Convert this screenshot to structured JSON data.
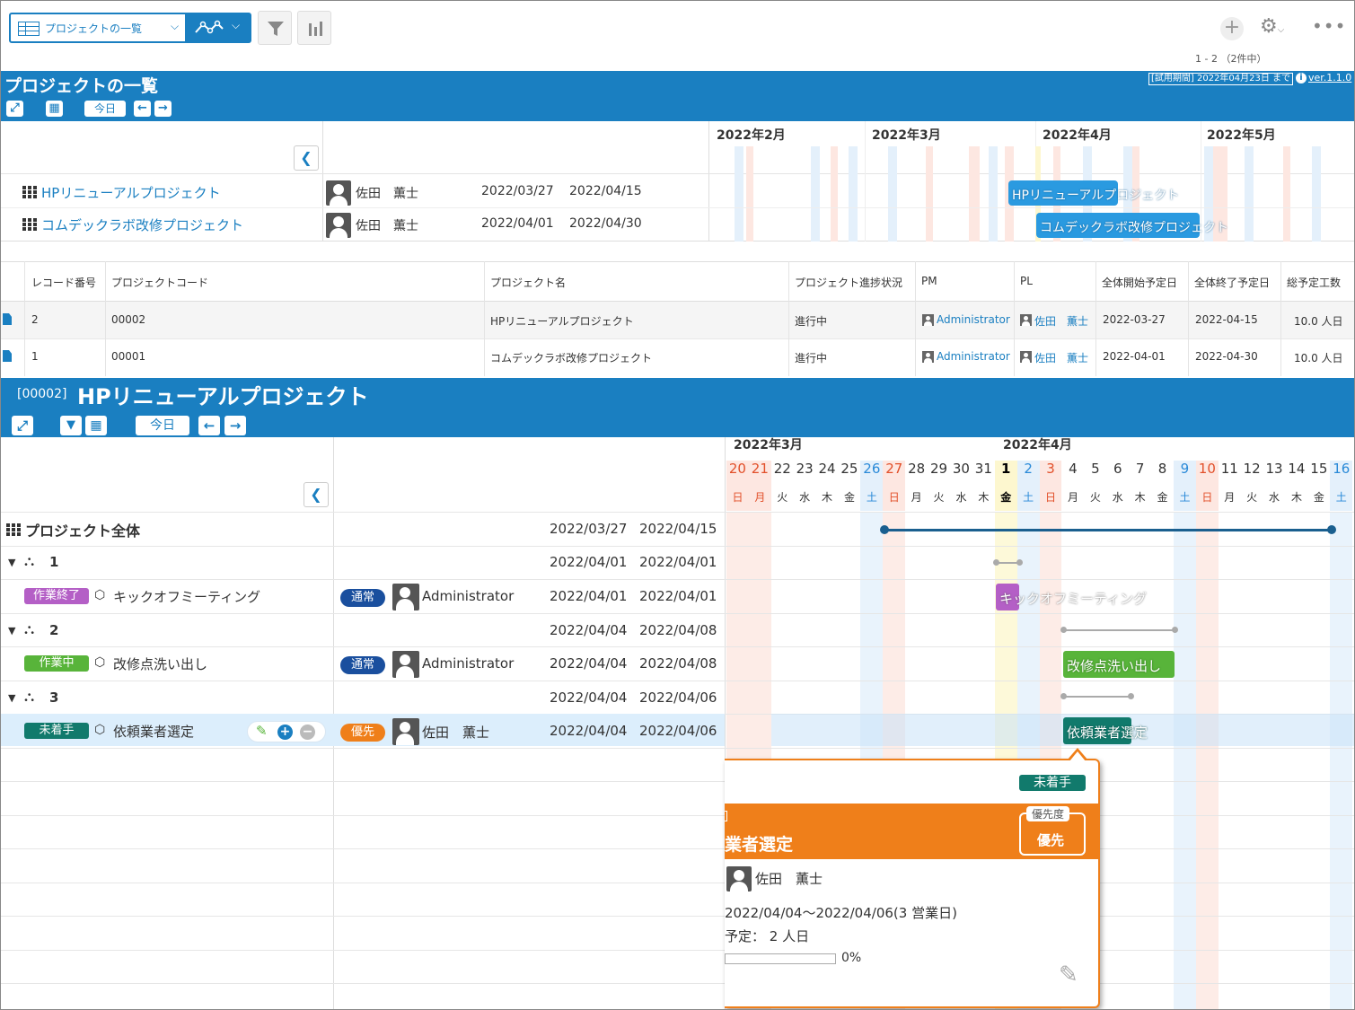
{
  "toolbar": {
    "view_select": "プロジェクトの一覧",
    "record_range": "1 - 2 （2件中）"
  },
  "banner": {
    "title": "プロジェクトの一覧",
    "trial": "[試用期間] 2022年04月23日 まで",
    "version": "ver.1.1.0",
    "today_label": "今日"
  },
  "overview_gantt": {
    "months": [
      "2022年2月",
      "2022年3月",
      "2022年4月",
      "2022年5月"
    ],
    "rows": [
      {
        "name": "HPリニューアルプロジェクト",
        "owner": "佐田　薫士",
        "start": "2022/03/27",
        "end": "2022/04/15",
        "bar_label": "HPリニューアルプロジェクト"
      },
      {
        "name": "コムデックラボ改修プロジェクト",
        "owner": "佐田　薫士",
        "start": "2022/04/01",
        "end": "2022/04/30",
        "bar_label": "コムデックラボ改修プロジェクト"
      }
    ]
  },
  "table": {
    "headers": [
      "レコード番号",
      "プロジェクトコード",
      "プロジェクト名",
      "プロジェクト進捗状況",
      "PM",
      "PL",
      "全体開始予定日",
      "全体終了予定日",
      "総予定工数"
    ],
    "rows": [
      {
        "no": "2",
        "code": "00002",
        "name": "HPリニューアルプロジェクト",
        "status": "進行中",
        "pm": "Administrator",
        "pl": "佐田　薫士",
        "start": "2022-03-27",
        "end": "2022-04-15",
        "effort": "10.0 人日"
      },
      {
        "no": "1",
        "code": "00001",
        "name": "コムデックラボ改修プロジェクト",
        "status": "進行中",
        "pm": "Administrator",
        "pl": "佐田　薫士",
        "start": "2022-04-01",
        "end": "2022-04-30",
        "effort": "10.0 人日"
      }
    ]
  },
  "detail": {
    "code": "[00002]",
    "title": "HPリニューアルプロジェクト",
    "today_label": "今日",
    "month_march": "2022年3月",
    "month_april": "2022年4月",
    "days": [
      "20",
      "21",
      "22",
      "23",
      "24",
      "25",
      "26",
      "27",
      "28",
      "29",
      "30",
      "31",
      "1",
      "2",
      "3",
      "4",
      "5",
      "6",
      "7",
      "8",
      "9",
      "10",
      "11",
      "12",
      "13",
      "14",
      "15",
      "16"
    ],
    "weekdays": [
      "日",
      "月",
      "火",
      "水",
      "木",
      "金",
      "土",
      "日",
      "月",
      "火",
      "水",
      "木",
      "金",
      "土",
      "日",
      "月",
      "火",
      "水",
      "木",
      "金",
      "土",
      "日",
      "月",
      "火",
      "水",
      "木",
      "金",
      "土"
    ],
    "rows": [
      {
        "label": "プロジェクト全体",
        "start": "2022/03/27",
        "end": "2022/04/15"
      },
      {
        "label": "1",
        "start": "2022/04/01",
        "end": "2022/04/01"
      },
      {
        "status": "作業終了",
        "label": "キックオフミーティング",
        "priority": "通常",
        "assignee": "Administrator",
        "start": "2022/04/01",
        "end": "2022/04/01",
        "bar_label": "キックオフミーティング"
      },
      {
        "label": "2",
        "start": "2022/04/04",
        "end": "2022/04/08"
      },
      {
        "status": "作業中",
        "label": "改修点洗い出し",
        "priority": "通常",
        "assignee": "Administrator",
        "start": "2022/04/04",
        "end": "2022/04/08",
        "bar_label": "改修点洗い出し"
      },
      {
        "label": "3",
        "start": "2022/04/04",
        "end": "2022/04/06"
      },
      {
        "status": "未着手",
        "label": "依頼業者選定",
        "priority": "優先",
        "assignee": "佐田　薫士",
        "start": "2022/04/04",
        "end": "2022/04/06",
        "bar_label": "依頼業者選定"
      }
    ]
  },
  "popup": {
    "status": "未着手",
    "title": "業者選定",
    "priority_caption": "優先度",
    "priority": "優先",
    "assignee": "佐田　薫士",
    "period": "2022/04/04～2022/04/06(3 営業日)",
    "plan": "予定： 2 人日",
    "progress_label": "0%",
    "progress": 0
  },
  "colors": {
    "header_blue": "#1a7fc1",
    "done_purple": "#b45fc6",
    "working_green": "#58b43a",
    "notstarted_teal": "#117a6c",
    "priority_orange": "#ef7f1a",
    "normal_navy": "#1a4f9e"
  }
}
